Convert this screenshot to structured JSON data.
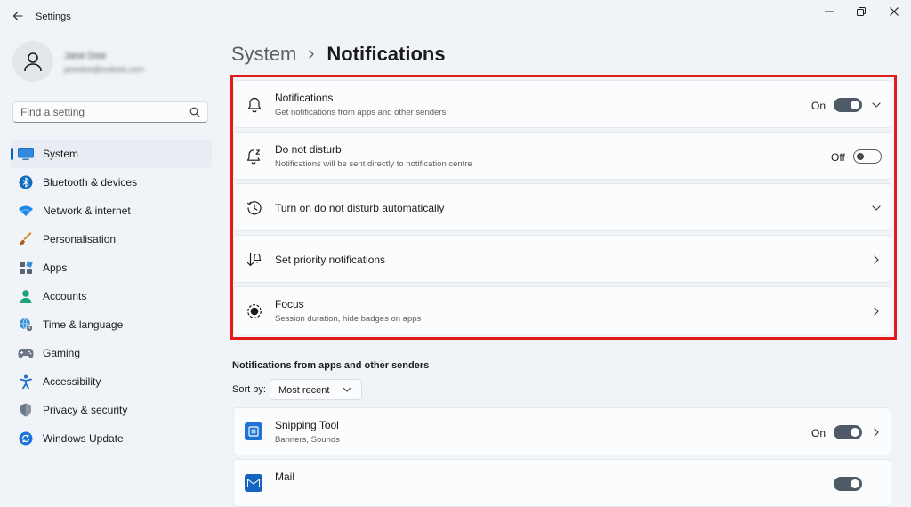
{
  "window": {
    "title": "Settings"
  },
  "profile": {
    "name": "Jane Doe",
    "email": "janedoe@outlook.com"
  },
  "search": {
    "placeholder": "Find a setting"
  },
  "sidebar": {
    "items": [
      {
        "label": "System",
        "icon": "monitor-icon",
        "active": true
      },
      {
        "label": "Bluetooth & devices",
        "icon": "bluetooth-icon"
      },
      {
        "label": "Network & internet",
        "icon": "wifi-icon"
      },
      {
        "label": "Personalisation",
        "icon": "brush-icon"
      },
      {
        "label": "Apps",
        "icon": "apps-icon"
      },
      {
        "label": "Accounts",
        "icon": "person-icon"
      },
      {
        "label": "Time & language",
        "icon": "globe-clock-icon"
      },
      {
        "label": "Gaming",
        "icon": "gamepad-icon"
      },
      {
        "label": "Accessibility",
        "icon": "accessibility-icon"
      },
      {
        "label": "Privacy & security",
        "icon": "shield-icon"
      },
      {
        "label": "Windows Update",
        "icon": "update-icon"
      }
    ]
  },
  "breadcrumb": {
    "parent": "System",
    "current": "Notifications"
  },
  "settings": [
    {
      "title": "Notifications",
      "subtitle": "Get notifications from apps and other senders",
      "state": "On",
      "icon": "bell-icon"
    },
    {
      "title": "Do not disturb",
      "subtitle": "Notifications will be sent directly to notification centre",
      "state": "Off",
      "icon": "bell-snooze-icon"
    },
    {
      "title": "Turn on do not disturb automatically",
      "icon": "clock-icon"
    },
    {
      "title": "Set priority notifications",
      "icon": "priority-sort-icon"
    },
    {
      "title": "Focus",
      "subtitle": "Session duration, hide badges on apps",
      "icon": "focus-icon"
    }
  ],
  "app_section": {
    "title": "Notifications from apps and other senders",
    "sort_label": "Sort by:",
    "sort_value": "Most recent"
  },
  "apps": [
    {
      "name": "Snipping Tool",
      "subtitle": "Banners, Sounds",
      "state": "On",
      "icon": "snipping-tool-icon"
    },
    {
      "name": "Mail",
      "icon": "mail-icon"
    }
  ],
  "colors": {
    "accent": "#0067c0",
    "highlight": "#e01b1b",
    "toggle_on": "#4e5a66"
  }
}
